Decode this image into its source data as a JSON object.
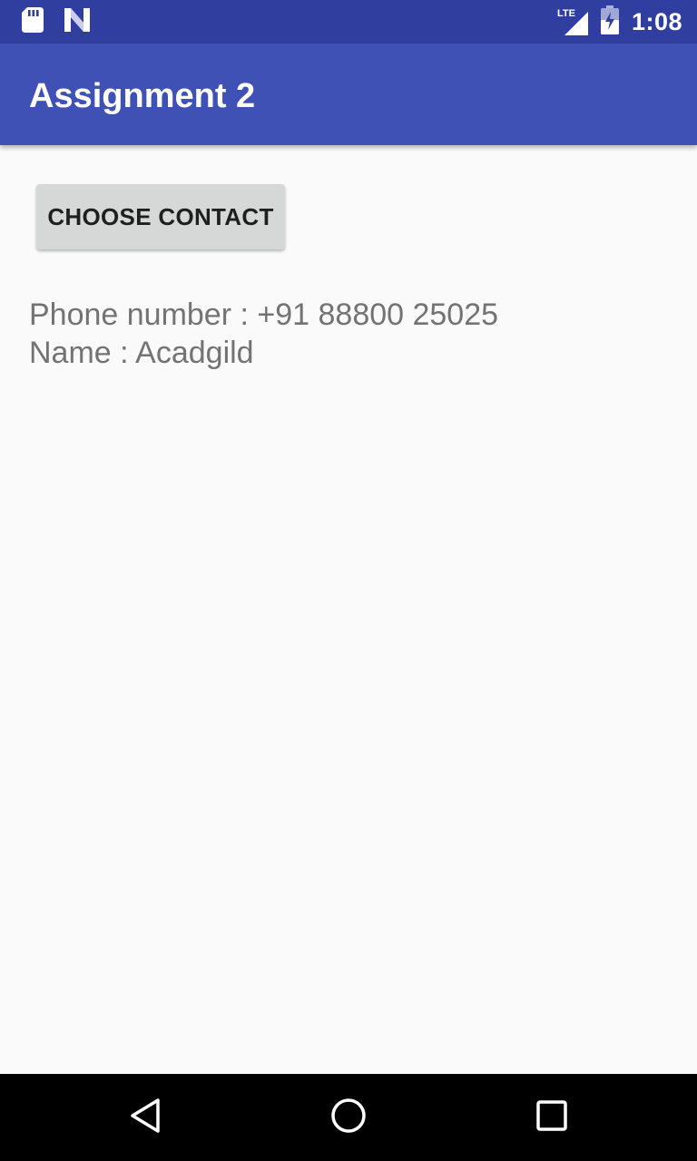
{
  "status_bar": {
    "time": "1:08",
    "network_label": "LTE",
    "icons": [
      "sd-card-icon",
      "notification-n-icon",
      "lte-signal-icon",
      "battery-charging-icon"
    ],
    "background_color": "#303f9f"
  },
  "app_bar": {
    "title": "Assignment 2",
    "background_color": "#3f51b5"
  },
  "main": {
    "choose_contact_button": "CHOOSE CONTACT",
    "phone_line": "Phone number : +91 88800 25025",
    "name_line": "Name : Acadgild"
  },
  "nav_bar": {
    "buttons": [
      "back-icon",
      "home-icon",
      "recents-icon"
    ]
  }
}
